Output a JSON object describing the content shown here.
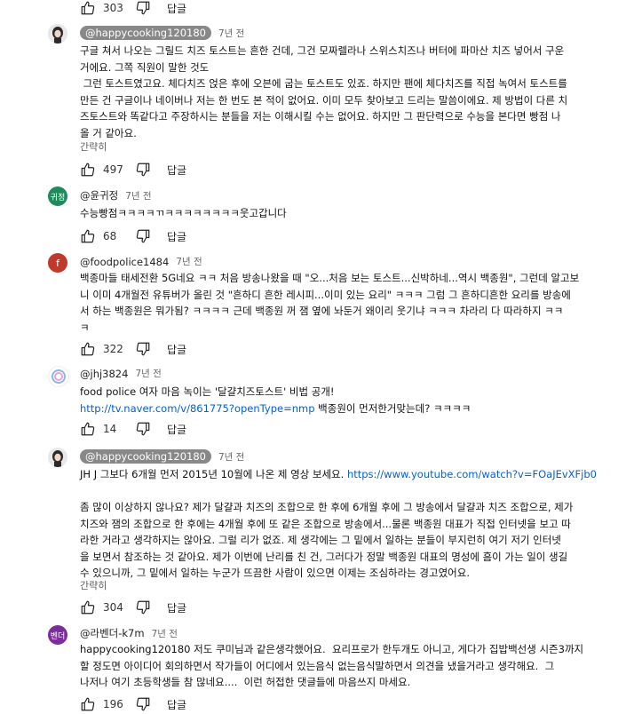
{
  "labels": {
    "reply": "답글",
    "show_less": "간략히"
  },
  "top_bar": {
    "likes": "303"
  },
  "comments": [
    {
      "handle": "@happycooking120180",
      "time": "7년 전",
      "lines": [
        "구글 쳐서 나오는 그릴드 치즈 토스트는 흔한 건데, 그건 모짜렐라나 스위스치즈나 버터에 파마산 치즈 넣어서 구운",
        "거에요. 그쪽 직원이 말한 것도",
        " 그런 토스트였고요. 체다치즈 얹은 후에 오븐에 굽는 토스트도 있죠. 하지만 팬에 체다치즈를 직접 녹여서 토스트를",
        "만든 건 구글이나 네이버나 저는 한 번도 본 적이 없어요. 이미 모두 찾아보고 드리는 말씀이에요. 제 방법이 다른 치",
        "즈토스트와 똑같다고 주장하시는 분들을 저는 이해시킬 수는 없어요. 하지만 그 판단력으로 수능을 본다면 빵점 나",
        "올 거 같아요."
      ],
      "likes": "497"
    },
    {
      "handle": "@윤귀정",
      "avatar_text": "귀정",
      "time": "7년 전",
      "lines": [
        "수능빵점ㅋㅋㅋㅋㄲㅋㅋㅋㅋㅋㅋㅋㅋ웃고갑니다"
      ],
      "likes": "68"
    },
    {
      "handle": "@foodpolice1484",
      "avatar_text": "f",
      "time": "7년 전",
      "lines": [
        "백종마들 태세전환 5G네요 ㅋㅋ 처음 방송나왔을 때 \"오...처음 보는 토스트...신박하네...역시 백종원\", 그런데 알고보",
        "니 이미 4개월전 유튜버가 올린 것 \"흔하디 흔한 레시피...이미 있는 요리\" ㅋㅋㅋ 그럼 그 흔하디흔한 요리를 방송에",
        "서 하는 백종원은 뭐가됨? ㅋㅋㅋㅋ 근데 백종원 꺼 잼 옆에 놔둔거 왜이리 웃기냐 ㅋㅋㅋ 차라리 다 따라하지 ㅋㅋ",
        "ㅋ"
      ],
      "likes": "322"
    },
    {
      "handle": "@jhj3824",
      "time": "7년 전",
      "line1": "food police 여자 마음 녹이는 '달걀치즈토스트' 비법 공개!",
      "link": "http://tv.naver.com/v/861775?openType=nmp",
      "after_link": " 백종원이 먼저한거맞는데? ㅋㅋㅋㅋ",
      "likes": "14"
    },
    {
      "handle": "@happycooking120180",
      "time": "7년 전",
      "line1_pre": "JH J 그보다 6개월 먼저 2015년 10월에 나온 제 영상 보세요. ",
      "link": "https://www.youtube.com/watch?v=FOaJEvXFjb0",
      "lines": [
        "좀 많이 이상하지 않나요? 제가 달걀과 치즈의 조합으로 한 후에 6개월 후에 그 방송에서 달걀과 치즈 조합으로, 제가",
        "치즈와 잼의 조합으로 한 후에는 4개월 후에 또 같은 조합으로 방송에서...물론 백종원 대표가 직접 인터넷을 보고 따",
        "라한 거라고 생각하지는 않아요. 그럴 리가 없죠. 제 생각에는 그 밑에서 일하는 분들이 부지런히 여기 저기 인터넷",
        "을 보면서 참조하는 것 같아요. 제가 이번에 난리를 친 건, 그러다가 정말 백종원 대표의 명성에 흠이 가는 일이 생길",
        "수 있으니까, 그 밑에서 일하는 누군가 뜨끔한 사람이 있으면 이제는 조심하라는 경고였어요."
      ],
      "likes": "304"
    },
    {
      "handle": "@라벤더-k7m",
      "avatar_text": "벤더",
      "time": "7년 전",
      "lines": [
        "happycooking120180 저도 쿠미님과 같은생각했어요.  요리프로가 한두개도 아니고, 게다가 집밥백선생 시즌3까지",
        "할 정도면 아이디어 회의하면서 작가들이 어디에서 있는음식 없는음식말하면서 의견을 냈을거라고 생각해요.  그",
        "나저나 여기 초등학생들 참 많네요....  이런 허접한 댓글들에 마음쓰지 마세요."
      ],
      "likes": "196"
    }
  ],
  "colors": {
    "link": "#065fd4",
    "yun_avatar": "#1f8a5a",
    "food_avatar": "#c0392b",
    "lav_avatar": "#7b2d9c"
  }
}
